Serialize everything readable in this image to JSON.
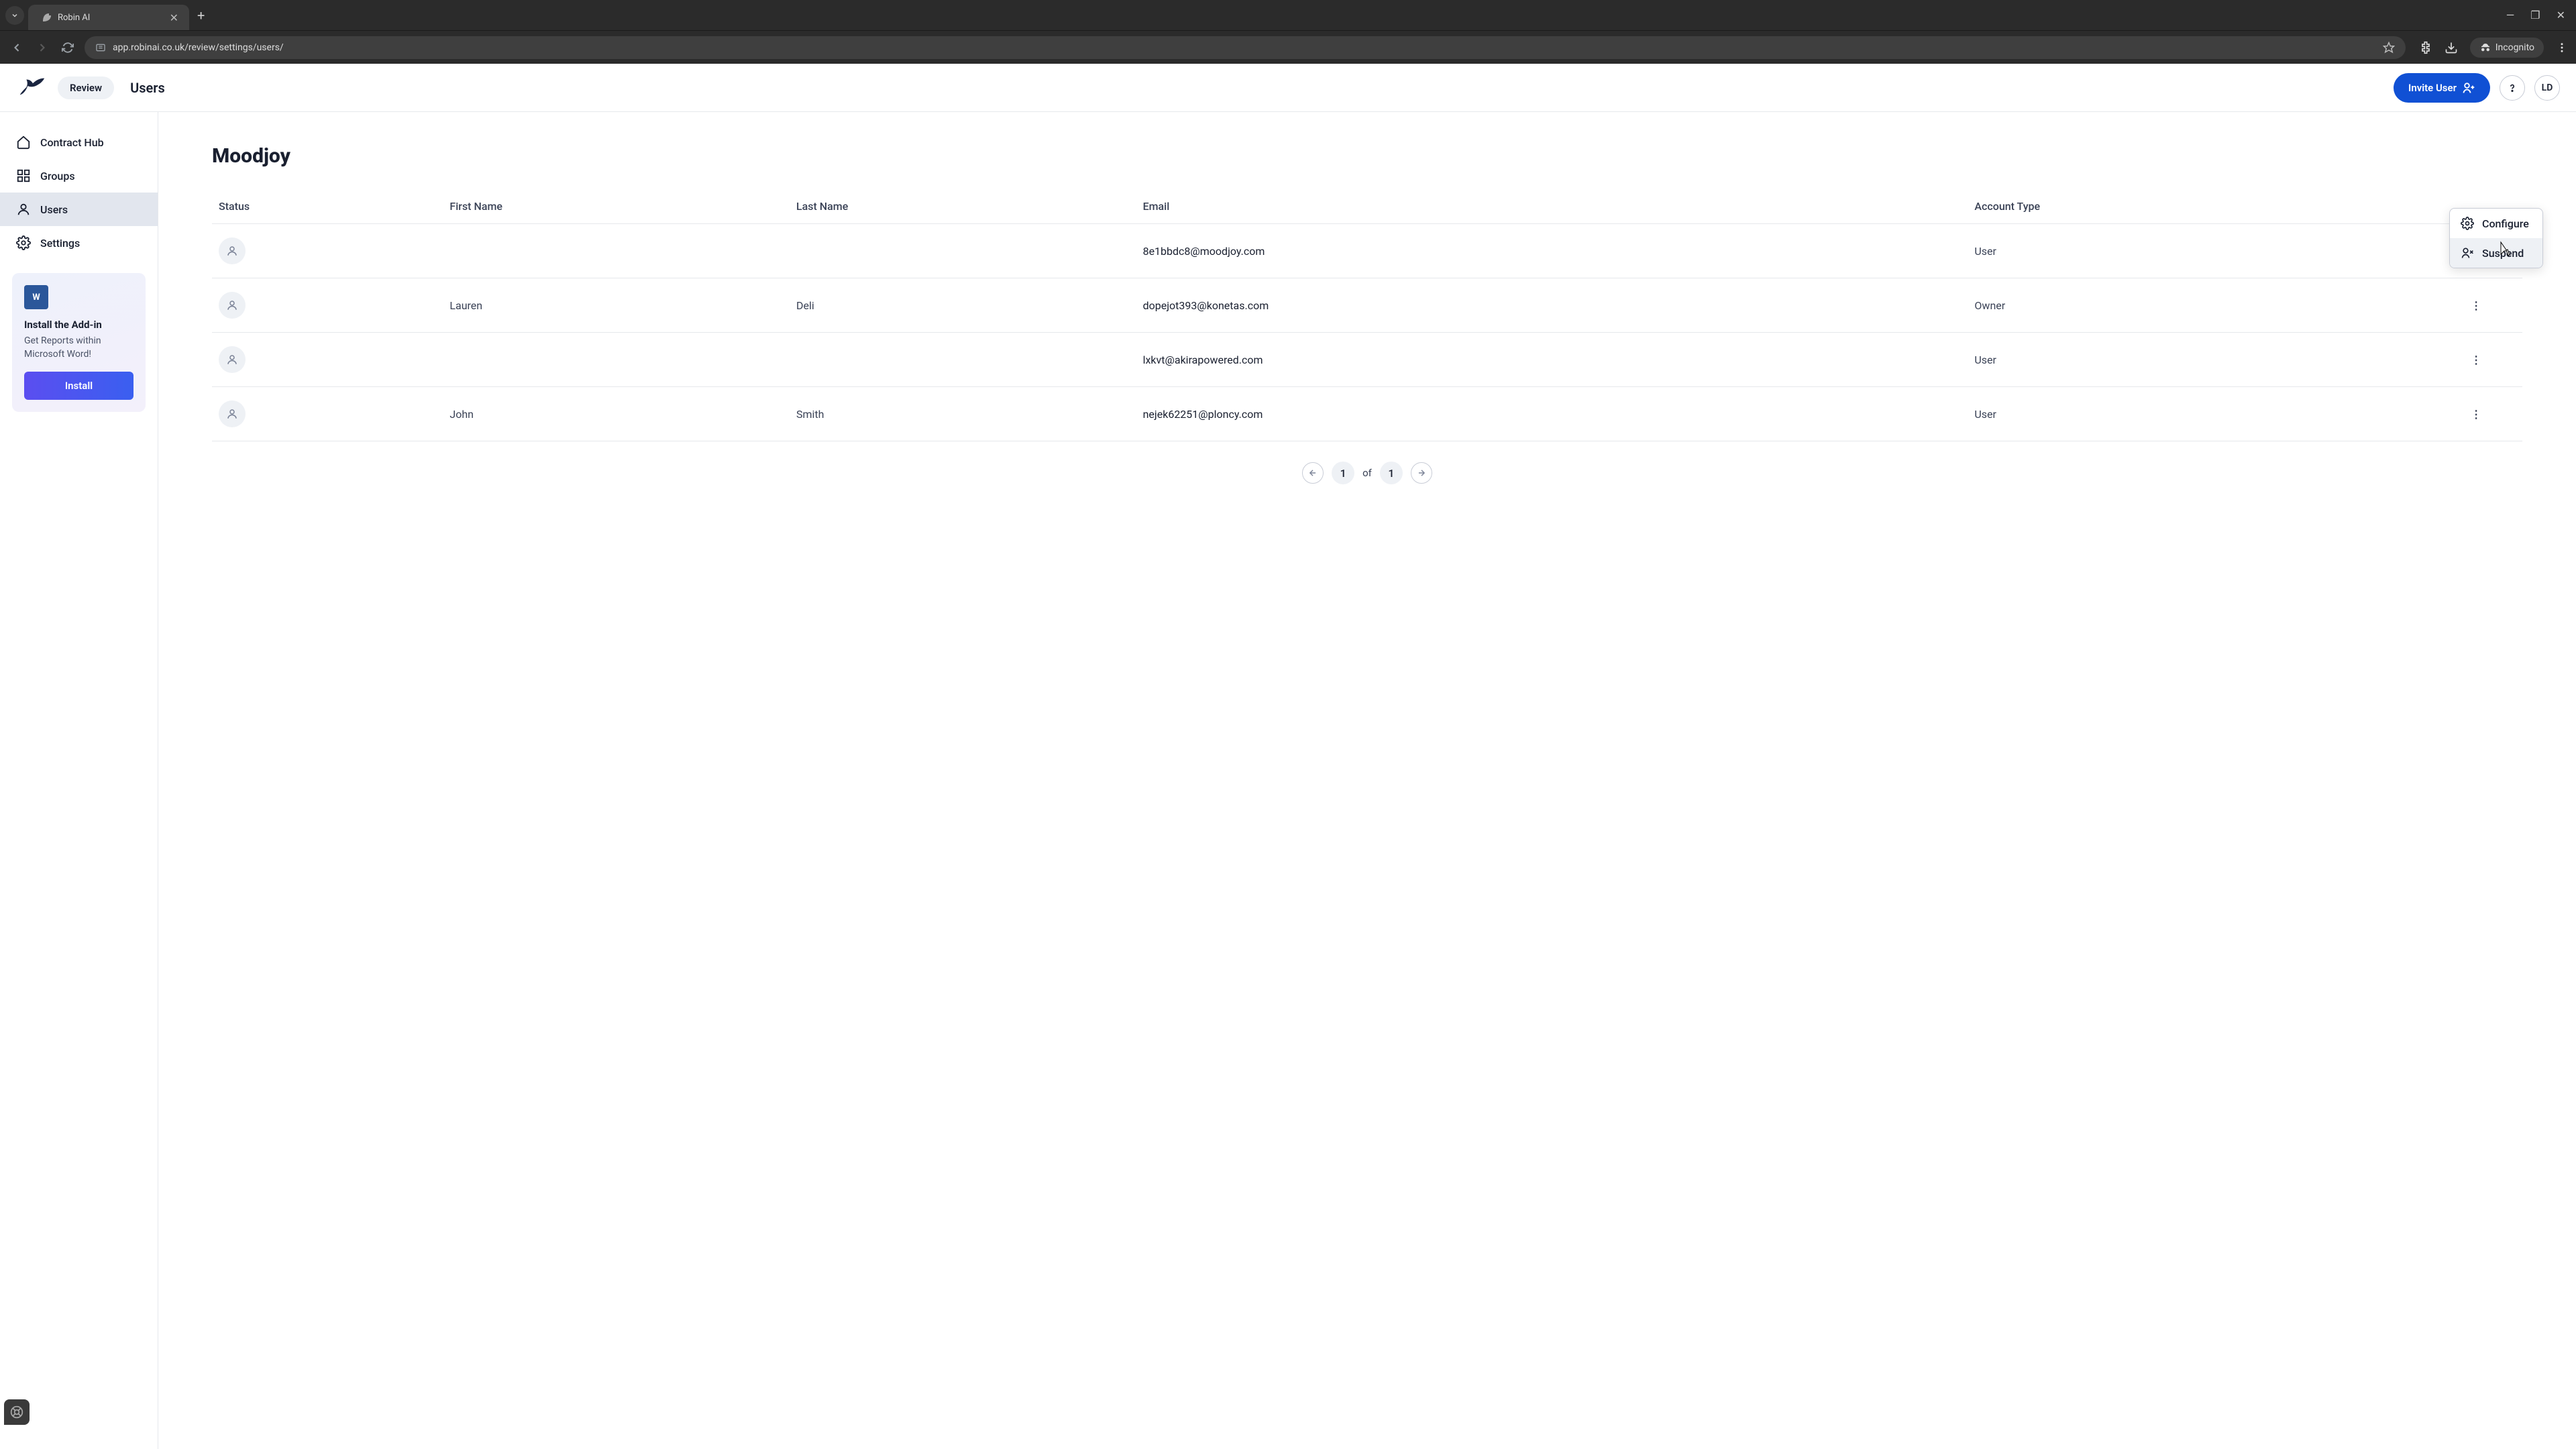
{
  "browser": {
    "tab_title": "Robin AI",
    "url": "app.robinai.co.uk/review/settings/users/",
    "incognito_label": "Incognito"
  },
  "header": {
    "review_label": "Review",
    "page_title": "Users",
    "invite_label": "Invite User",
    "avatar_initials": "LD"
  },
  "sidebar": {
    "items": [
      {
        "label": "Contract Hub",
        "icon": "home"
      },
      {
        "label": "Groups",
        "icon": "grid"
      },
      {
        "label": "Users",
        "icon": "user"
      },
      {
        "label": "Settings",
        "icon": "gear"
      }
    ],
    "addon": {
      "title": "Install the Add-in",
      "subtitle": "Get Reports within Microsoft Word!",
      "button": "Install",
      "word_icon_text": "W"
    }
  },
  "main": {
    "org_title": "Moodjoy",
    "columns": {
      "status": "Status",
      "first_name": "First Name",
      "last_name": "Last Name",
      "email": "Email",
      "account_type": "Account Type"
    },
    "rows": [
      {
        "first_name": "",
        "last_name": "",
        "email": "8e1bbdc8@moodjoy.com",
        "account_type": "User"
      },
      {
        "first_name": "Lauren",
        "last_name": "Deli",
        "email": "dopejot393@konetas.com",
        "account_type": "Owner"
      },
      {
        "first_name": "",
        "last_name": "",
        "email": "lxkvt@akirapowered.com",
        "account_type": "User"
      },
      {
        "first_name": "John",
        "last_name": "Smith",
        "email": "nejek62251@ploncy.com",
        "account_type": "User"
      }
    ],
    "dropdown": {
      "configure": "Configure",
      "suspend": "Suspend"
    },
    "pagination": {
      "current": "1",
      "of_label": "of",
      "total": "1"
    }
  }
}
